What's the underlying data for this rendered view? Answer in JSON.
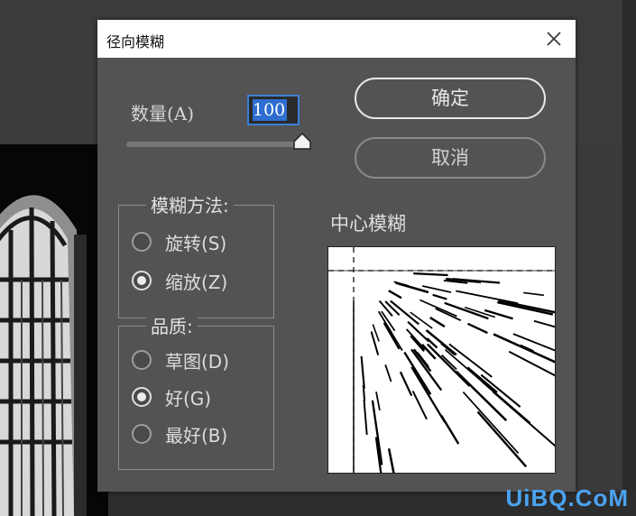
{
  "dialog": {
    "title": "径向模糊",
    "amount_label": "数量(A)",
    "amount_value": "100",
    "slider_value": 100,
    "ok_label": "确定",
    "cancel_label": "取消",
    "method_group": {
      "legend": "模糊方法:",
      "options": [
        {
          "label": "旋转(S)",
          "checked": false
        },
        {
          "label": "缩放(Z)",
          "checked": true
        }
      ]
    },
    "quality_group": {
      "legend": "品质:",
      "options": [
        {
          "label": "草图(D)",
          "checked": false
        },
        {
          "label": "好(G)",
          "checked": true
        },
        {
          "label": "最好(B)",
          "checked": false
        }
      ]
    },
    "center_label": "中心模糊"
  },
  "watermark": "UiBQ.CoM",
  "colors": {
    "dialog_bg": "#535353",
    "title_bg": "#ffffff",
    "input_border": "#3b7fd8",
    "selection": "#2f6ed0",
    "watermark": "#4aa3f0"
  }
}
